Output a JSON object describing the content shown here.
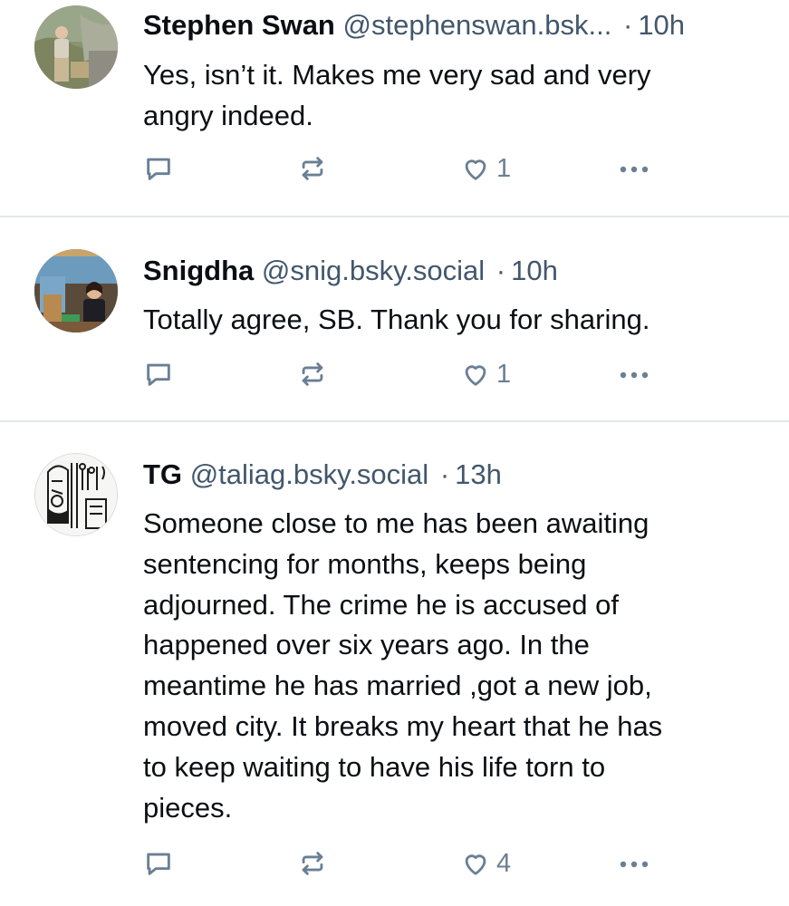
{
  "posts": [
    {
      "name": "Stephen Swan",
      "handle": "@stephenswan.bsk...",
      "time": "10h",
      "separator": "·",
      "text_lines": [
        "Yes, isn’t it. Makes me very sad and very",
        "angry indeed."
      ],
      "likes": "1"
    },
    {
      "name": "Snigdha",
      "handle": "@snig.bsky.social",
      "time": "10h",
      "separator": "·",
      "text_lines": [
        "Totally agree, SB. Thank you for sharing."
      ],
      "likes": "1"
    },
    {
      "name": "TG",
      "handle": "@taliag.bsky.social",
      "time": "13h",
      "separator": "·",
      "text_lines": [
        "Someone close to me has been awaiting",
        "sentencing for months, keeps being",
        "adjourned. The crime he is accused of",
        "happened over six years ago. In the",
        "meantime he has married ,got a new job,",
        "moved city. It breaks my heart that he has",
        "to keep waiting to have his life torn to",
        "pieces."
      ],
      "likes": "4"
    }
  ],
  "icons": {
    "reply": "reply-icon",
    "repost": "repost-icon",
    "like": "heart-icon",
    "more": "more-options-icon"
  },
  "colors": {
    "text": "#0b0f14",
    "secondary": "#42576c",
    "icon": "#6a7f94",
    "divider": "#e3e7ec"
  }
}
